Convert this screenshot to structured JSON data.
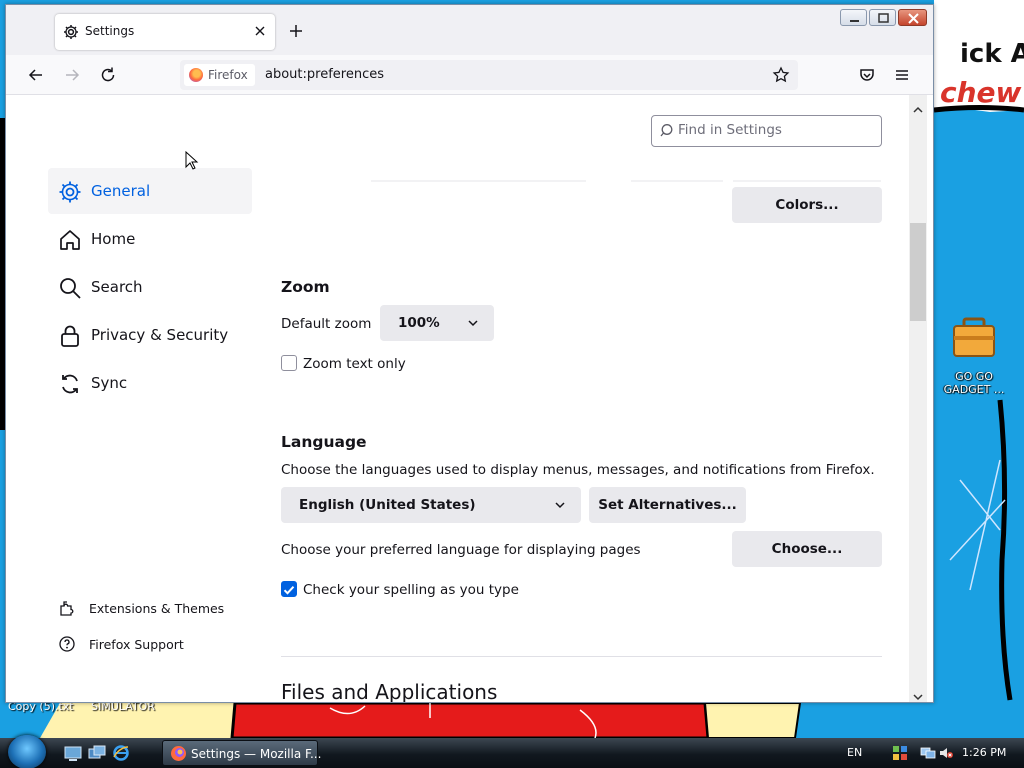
{
  "desktop": {
    "wallpaper_text_1": "ick A",
    "wallpaper_text_2": "chew",
    "icon_label": "GO GO GADGET ...",
    "files": [
      "Copy (5).txt",
      "SIMULATOR"
    ]
  },
  "browser": {
    "tab_title": "Settings",
    "identity_label": "Firefox",
    "url": "about:preferences"
  },
  "sidebar": {
    "items": [
      {
        "label": "General",
        "icon": "gear-icon",
        "selected": true
      },
      {
        "label": "Home",
        "icon": "home-icon"
      },
      {
        "label": "Search",
        "icon": "search-icon"
      },
      {
        "label": "Privacy & Security",
        "icon": "lock-icon"
      },
      {
        "label": "Sync",
        "icon": "sync-icon"
      }
    ],
    "footer": [
      {
        "label": "Extensions & Themes",
        "icon": "puzzle-icon"
      },
      {
        "label": "Firefox Support",
        "icon": "help-icon"
      }
    ]
  },
  "search": {
    "placeholder": "Find in Settings"
  },
  "colors_button": "Colors...",
  "zoom": {
    "heading": "Zoom",
    "default_label": "Default zoom",
    "default_value": "100%",
    "text_only_label": "Zoom text only",
    "text_only_checked": false
  },
  "language": {
    "heading": "Language",
    "description": "Choose the languages used to display menus, messages, and notifications from Firefox.",
    "selected": "English (United States)",
    "set_alternatives": "Set Alternatives...",
    "pages_label": "Choose your preferred language for displaying pages",
    "choose_button": "Choose...",
    "spelling_label": "Check your spelling as you type",
    "spelling_checked": true
  },
  "files_heading": "Files and Applications",
  "taskbar": {
    "task_label": "Settings — Mozilla F...",
    "lang": "EN",
    "clock": "1:26 PM"
  },
  "colors": {
    "accent": "#0061e0",
    "desktop": "#1aa0e2"
  }
}
